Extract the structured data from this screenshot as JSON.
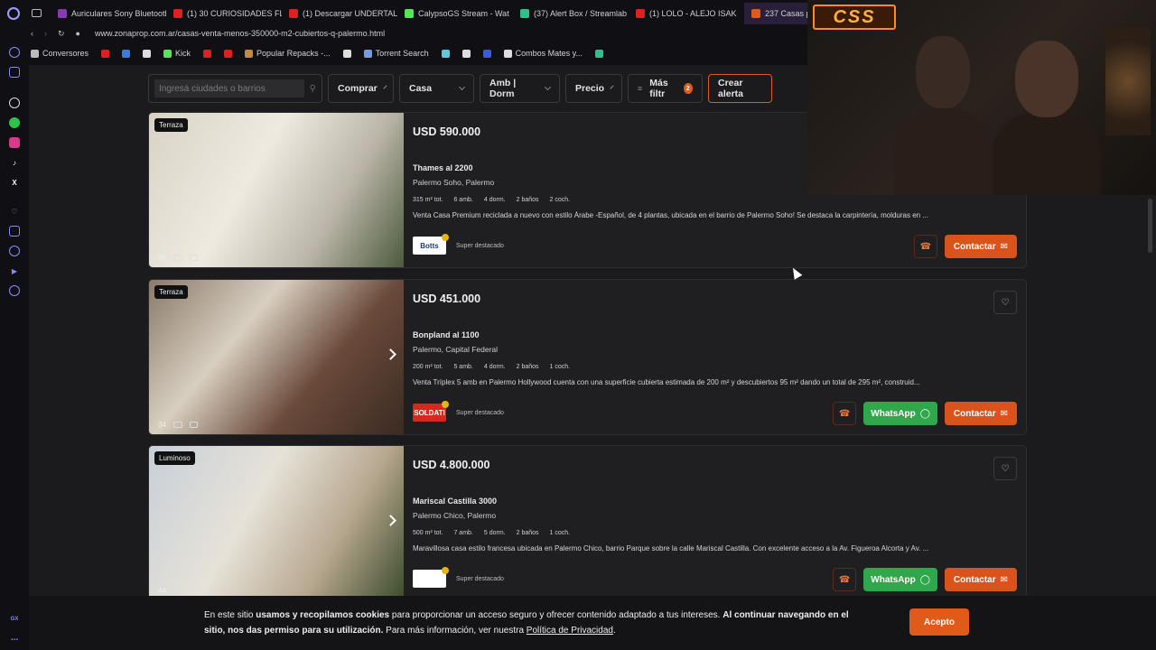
{
  "browser": {
    "tabs": [
      {
        "label": "Auriculares Sony Bluetooth",
        "color": "#8a3ab0"
      },
      {
        "label": "(1) 30 CURIOSIDADES FLIP",
        "color": "#e02020"
      },
      {
        "label": "(1) Descargar UNDERTALE",
        "color": "#e02020"
      },
      {
        "label": "CalypsoGS Stream - Wat",
        "color": "#53e553"
      },
      {
        "label": "(37) Alert Box / Streamlab",
        "color": "#2ec28a"
      },
      {
        "label": "(1) LOLO - ALEJO ISAK",
        "color": "#e02020"
      },
      {
        "label": "237 Casas pa",
        "color": "#e05a1a"
      }
    ],
    "url": "www.zonaprop.com.ar/casas-venta-menos-350000-m2-cubiertos-q-palermo.html",
    "bookmarks": [
      {
        "label": "Conversores",
        "color": "#bbbbbb"
      },
      {
        "label": "",
        "color": "#e02020"
      },
      {
        "label": "",
        "color": "#3a7be0"
      },
      {
        "label": "",
        "color": "#dddddd"
      },
      {
        "label": "Kick",
        "color": "#53e553"
      },
      {
        "label": "",
        "color": "#e02020"
      },
      {
        "label": "",
        "color": "#e02020"
      },
      {
        "label": "Popular Repacks -...",
        "color": "#c08a40"
      },
      {
        "label": "",
        "color": "#dddddd"
      },
      {
        "label": "Torrent Search",
        "color": "#7a9ae0"
      },
      {
        "label": "",
        "color": "#5ac8e0"
      },
      {
        "label": "",
        "color": "#dddddd"
      },
      {
        "label": "",
        "color": "#3a5ae0"
      },
      {
        "label": "Combos Mates y...",
        "color": "#dddddd"
      },
      {
        "label": "",
        "color": "#2ec28a"
      }
    ]
  },
  "webcam": {
    "logo_text": "CSS"
  },
  "filters": {
    "search_placeholder": "Ingresá ciudades o barrios",
    "operation": "Comprar",
    "type": "Casa",
    "rooms": "Amb | Dorm",
    "price": "Precio",
    "more": "Más filtr",
    "more_badge": "2",
    "alert": "Crear alerta"
  },
  "listings": [
    {
      "tag": "Terraza",
      "photo_count": "46",
      "price": "USD 590.000",
      "street": "Thames al 2200",
      "hood": "Palermo Soho, Palermo",
      "features": [
        "315 m² tot.",
        "6 amb.",
        "4 dorm.",
        "2 baños",
        "2 coch."
      ],
      "description": "Venta Casa Premium reciclada a nuevo con estilo Árabe -Español, de 4 plantas, ubicada en el barrio de Palermo Soho! Se destaca la carpintería, molduras en ...",
      "agency": "Botts",
      "agency_bg": "#ffffff",
      "agency_fg": "#1a3a6a",
      "highlight": "Super destacado",
      "contact_label": "Contactar",
      "whatsapp_label": "",
      "photo_bg": "linear-gradient(120deg, #d8d2c6 0%, #efeae0 40%, #bcb6aa 70%, #4a5a3a 100%)"
    },
    {
      "tag": "Terraza",
      "photo_count": "34",
      "price": "USD 451.000",
      "street": "Bonpland al 1100",
      "hood": "Palermo, Capital Federal",
      "features": [
        "200 m² tot.",
        "5 amb.",
        "4 dorm.",
        "2 baños",
        "1 coch."
      ],
      "description": "Venta Tríplex 5 amb en Palermo Hollywood cuenta con una superficie cubierta estimada de 200 m² y descubiertos 95 m² dando un total de 295 m², construid...",
      "agency": "SOLDATI",
      "agency_bg": "#d42a1e",
      "agency_fg": "#ffffff",
      "highlight": "Super destacado",
      "contact_label": "Contactar",
      "whatsapp_label": "WhatsApp",
      "photo_bg": "linear-gradient(130deg, #8a7a6a 0%, #d8cfc0 35%, #6a4a3a 65%, #3a2a22 100%)"
    },
    {
      "tag": "Luminoso",
      "photo_count": "44",
      "price": "USD 4.800.000",
      "street": "Mariscal Castilla 3000",
      "hood": "Palermo Chico, Palermo",
      "features": [
        "500 m² tot.",
        "7 amb.",
        "5 dorm.",
        "2 baños",
        "1 coch."
      ],
      "description": "Maravillosa casa estilo francesa ubicada en Palermo Chico, barrio Parque sobre la calle Mariscal Castilla. Con excelente acceso a la Av. Figueroa Alcorta y Av. ...",
      "agency": "",
      "agency_bg": "#ffffff",
      "agency_fg": "#333333",
      "highlight": "Super destacado",
      "contact_label": "Contactar",
      "whatsapp_label": "WhatsApp",
      "photo_bg": "linear-gradient(120deg, #c8cfd8 0%, #e6e2d8 40%, #b8a890 70%, #3a4a2a 100%)"
    }
  ],
  "cookie": {
    "t1": "En este sitio ",
    "b1": "usamos y recopilamos cookies",
    "t2": " para proporcionar un acceso seguro y ofrecer contenido adaptado a tus intereses. ",
    "b2": "Al continuar navegando en el sitio, nos das permiso para su utilización.",
    "t3": " Para más información, ver nuestra ",
    "link": "Política de Privacidad",
    "t4": ".",
    "accept": "Acepto"
  },
  "sidebar": {
    "bottom_label": "GX"
  },
  "colors": {
    "accent": "#e05a1a",
    "whatsapp": "#2ea84b",
    "background": "#1b1b1d"
  }
}
